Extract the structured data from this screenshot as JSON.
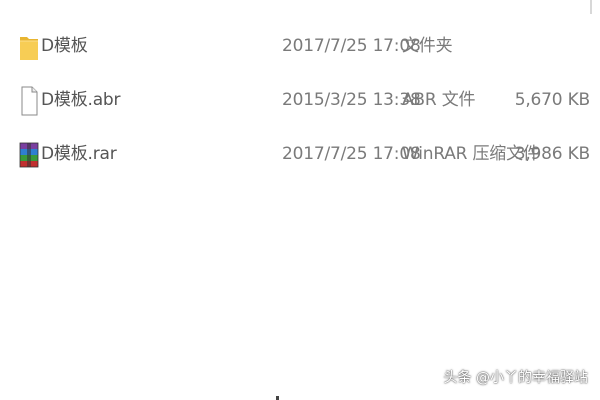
{
  "files": [
    {
      "name": "D模板",
      "date": "2017/7/25 17:08",
      "type": "文件夹",
      "size": "",
      "icon": "folder-icon"
    },
    {
      "name": "D模板.abr",
      "date": "2015/3/25 13:38",
      "type": "ABR 文件",
      "size": "5,670 KB",
      "icon": "document-icon"
    },
    {
      "name": "D模板.rar",
      "date": "2017/7/25 17:08",
      "type": "WinRAR 压缩文件",
      "size": "3,986 KB",
      "icon": "winrar-archive-icon"
    }
  ],
  "watermark": "头条 @小丫的幸福驿站",
  "colors": {
    "folder": "#f5c542",
    "text": "#6a6a6a"
  }
}
